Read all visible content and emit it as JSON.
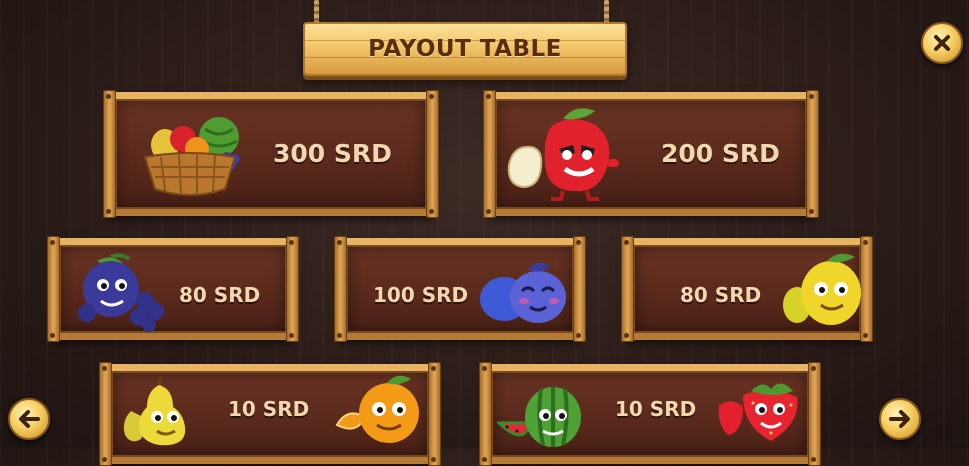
{
  "header": {
    "title": "PAYOUT TABLE"
  },
  "controls": {
    "close_icon": "close-x-icon",
    "prev_icon": "arrow-left-icon",
    "next_icon": "arrow-right-icon"
  },
  "rows": [
    [
      {
        "symbol": "fruit-basket",
        "payout": "300 SRD"
      },
      {
        "symbol": "apple",
        "payout": "200 SRD"
      }
    ],
    [
      {
        "symbol": "grapes",
        "payout": "80 SRD"
      },
      {
        "symbol": "plums",
        "payout": "100 SRD"
      },
      {
        "symbol": "lemon",
        "payout": "80 SRD"
      }
    ],
    [
      {
        "symbol": "pear",
        "payout": "10 SRD"
      },
      {
        "symbol": "orange",
        "payout": "10 SRD"
      },
      {
        "symbol": "watermelon",
        "payout": "10 SRD"
      },
      {
        "symbol": "strawberry",
        "payout": "10 SRD"
      }
    ]
  ],
  "colors": {
    "board": "#f1c66a",
    "frame": "#d19a4f",
    "panel": "#5a2a1c",
    "text": "#f3d7ae",
    "button": "#f5cf63"
  }
}
